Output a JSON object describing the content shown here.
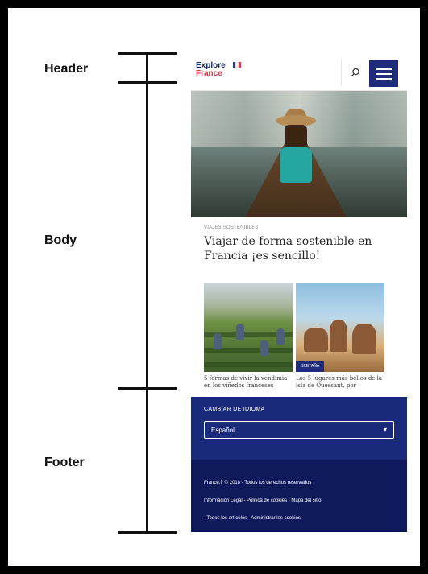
{
  "annotations": {
    "header": "Header",
    "body": "Body",
    "footer": "Footer"
  },
  "header": {
    "logo_line1": "Explore",
    "logo_line2": "France",
    "search_icon": "search-icon",
    "menu_icon": "hamburger-icon"
  },
  "article": {
    "kicker": "VIAJES SOSTENIBLES",
    "title": "Viajar de forma sostenible en Francia ¡es sencillo!"
  },
  "cards": [
    {
      "text": "5 formas de vivir la vendimia en los viñedos franceses"
    },
    {
      "tag": "BRETAÑA",
      "text": "Los 5 lugares más bellos de la isla de Ouessant, por"
    }
  ],
  "footer": {
    "language_label": "CAMBIAR DE IDIOMA",
    "language_value": "Español",
    "copyright": "France.fr © 2018 - Todos los derechos reservados",
    "links_line1": "Información Legal - Política de cookies - Mapa del sitio",
    "links_line2": "- Todos los artículos - Administrar las cookies"
  },
  "colors": {
    "brand_navy": "#1f2c7c",
    "footer_top": "#1a2a7a",
    "footer_bottom": "#0f1a5c",
    "logo_red": "#e0334b",
    "flag_blue": "#1f3fa0",
    "flag_white": "#ffffff",
    "flag_red": "#e0334b"
  }
}
